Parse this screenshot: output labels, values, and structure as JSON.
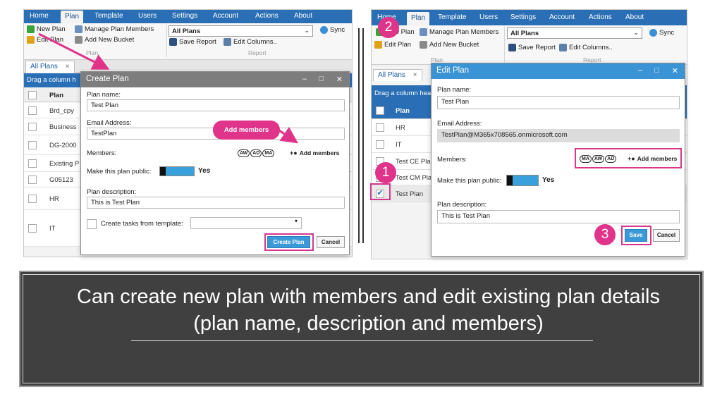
{
  "colors": {
    "brand_blue": "#2a6fb5",
    "highlight_pink": "#e0338a",
    "panel_bg": "#404040",
    "button_blue": "#3c99d8"
  },
  "left": {
    "menu": [
      "Home",
      "Plan",
      "Template",
      "Users",
      "Settings",
      "Account",
      "Actions",
      "About"
    ],
    "ribbon": {
      "new_plan": "New Plan",
      "edit_plan": "Edit Plan",
      "manage_members": "Manage Plan Members",
      "add_bucket": "Add New Bucket",
      "plans_dropdown": "All Plans",
      "sync": "Sync",
      "save_report": "Save Report",
      "edit_columns": "Edit Columns..",
      "group_plan": "Plan",
      "group_report": "Report"
    },
    "tab": "All Plans",
    "tab_close": "×",
    "drag_hint": "Drag a column h",
    "col_plan": "Plan",
    "rows": [
      "Brd_cpy",
      "Business E",
      "DG-2000",
      "Existing Pl",
      "G05123",
      "HR",
      "IT"
    ],
    "dialog": {
      "title": "Create Plan",
      "plan_name_label": "Plan name:",
      "plan_name_value": "Test Plan",
      "email_label": "Email Address:",
      "email_value": "TestPlan",
      "members_label": "Members:",
      "avatars": [
        "AW",
        "AD",
        "MA"
      ],
      "add_members": "Add members",
      "public_label": "Make this plan public:",
      "public_value": "Yes",
      "desc_label": "Plan description:",
      "desc_value": "This is Test Plan",
      "template_label": "Create tasks from template:",
      "primary": "Create Plan",
      "cancel": "Cancel",
      "callout": "Add members"
    }
  },
  "right": {
    "menu": [
      "Home",
      "Plan",
      "Template",
      "Users",
      "Settings",
      "Account",
      "Actions",
      "About"
    ],
    "ribbon": {
      "new_plan": "New Plan",
      "edit_plan": "Edit Plan",
      "manage_members": "Manage Plan Members",
      "add_bucket": "Add New Bucket",
      "plans_dropdown": "All Plans",
      "sync": "Sync",
      "save_report": "Save Report",
      "edit_columns": "Edit Columns..",
      "group_plan": "Plan",
      "group_report": "Report"
    },
    "tab": "All Plans",
    "tab_close": "×",
    "drag_hint": "Drag a column hea",
    "col_plan": "Plan",
    "rows": [
      "HR",
      "IT",
      "Test CE Plan",
      "Test CM Plan",
      "Test Plan"
    ],
    "dialog": {
      "title": "Edit Plan",
      "plan_name_label": "Plan name:",
      "plan_name_value": "Test Plan",
      "email_label": "Email Address:",
      "email_value": "TestPlan@M365x708565.onmicrosoft.com",
      "members_label": "Members:",
      "avatars": [
        "MA",
        "AW",
        "AD"
      ],
      "add_members": "Add members",
      "public_label": "Make this plan public:",
      "public_value": "Yes",
      "desc_label": "Plan description:",
      "desc_value": "This is Test Plan",
      "primary": "Save",
      "cancel": "Cancel"
    },
    "step_numbers": [
      "1",
      "2",
      "3"
    ]
  },
  "caption": {
    "line1": "Can create new plan with members and edit existing plan details",
    "line2": "(plan name, description and members)"
  }
}
